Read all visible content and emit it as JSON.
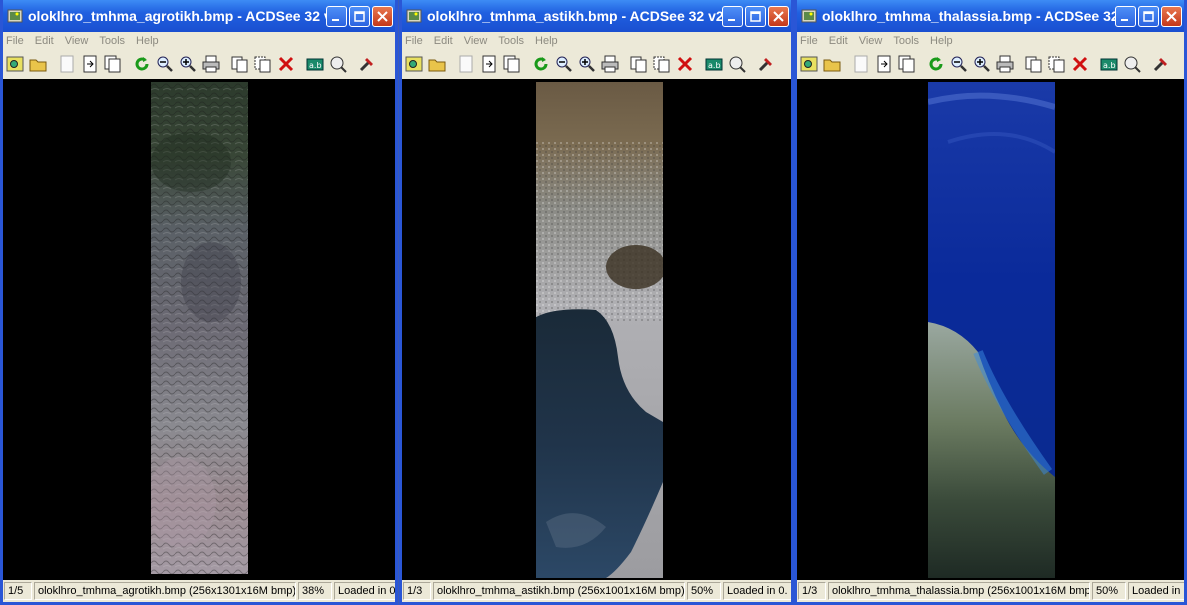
{
  "windows": [
    {
      "title": "oloklhro_tmhma_agrotikh.bmp - ACDSee 32 v...",
      "menu": [
        "File",
        "Edit",
        "View",
        "Tools",
        "Help"
      ],
      "status": {
        "index": "1/5",
        "info": "oloklhro_tmhma_agrotikh.bmp (256x1301x16M bmp)",
        "zoom": "38%",
        "loaded": "Loaded in 0"
      }
    },
    {
      "title": "oloklhro_tmhma_astikh.bmp - ACDSee 32 v2....",
      "menu": [
        "File",
        "Edit",
        "View",
        "Tools",
        "Help"
      ],
      "status": {
        "index": "1/3",
        "info": "oloklhro_tmhma_astikh.bmp (256x1001x16M bmp)",
        "zoom": "50%",
        "loaded": "Loaded in 0."
      }
    },
    {
      "title": "oloklhro_tmhma_thalassia.bmp - ACDSee 32 ...",
      "menu": [
        "File",
        "Edit",
        "View",
        "Tools",
        "Help"
      ],
      "status": {
        "index": "1/3",
        "info": "oloklhro_tmhma_thalassia.bmp (256x1001x16M bmp)",
        "zoom": "50%",
        "loaded": "Loaded in"
      }
    }
  ],
  "colors": {
    "titlebar": "#2060e0",
    "chrome": "#ece9d8",
    "viewer_bg": "#000000"
  },
  "icons": [
    "browse-icon",
    "open-icon",
    "previous-icon",
    "next-icon",
    "fullscreen-icon",
    "rotate-icon",
    "zoom-out-icon",
    "zoom-in-icon",
    "print-icon",
    "copy-icon",
    "move-icon",
    "delete-icon",
    "rename-icon",
    "properties-icon",
    "tools-icon"
  ]
}
